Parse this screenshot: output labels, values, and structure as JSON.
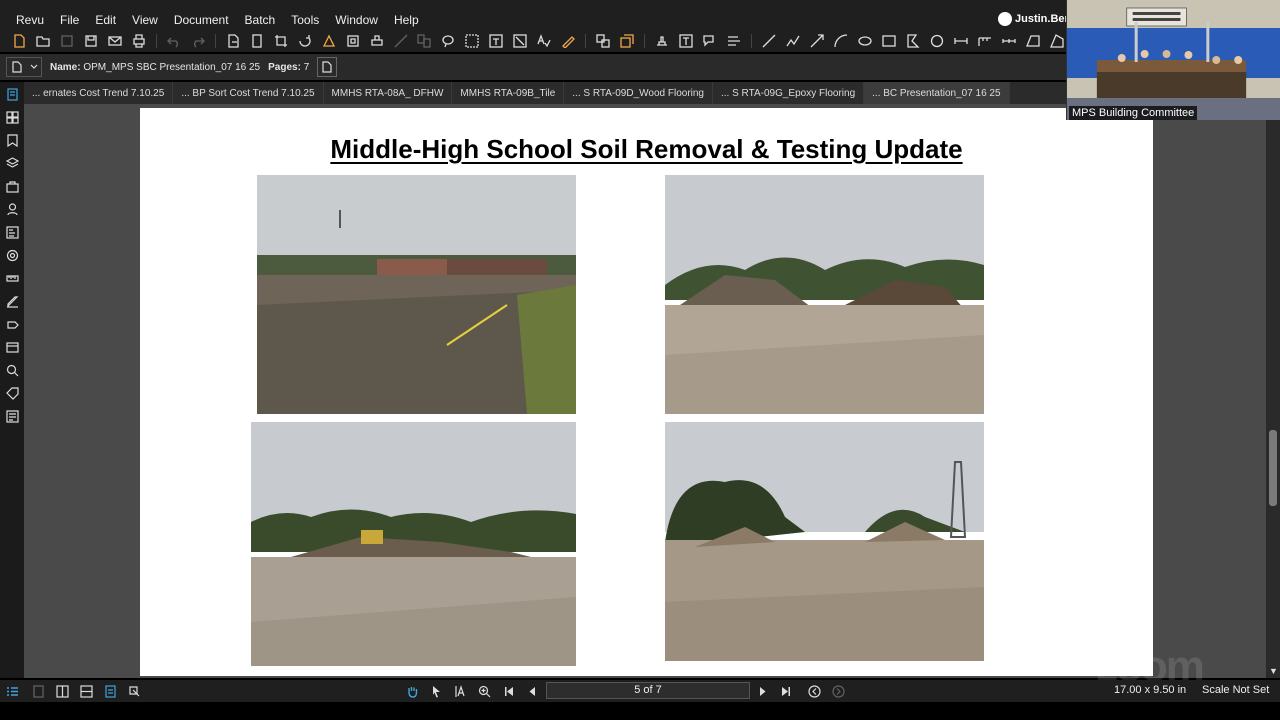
{
  "menu": [
    "Revu",
    "File",
    "Edit",
    "View",
    "Document",
    "Batch",
    "Tools",
    "Window",
    "Help"
  ],
  "user": {
    "name": "Justin.Bern"
  },
  "doc_info": {
    "name_label": "Name:",
    "name_value": "OPM_MPS SBC Presentation_07 16 25",
    "pages_label": "Pages:",
    "pages_value": "7"
  },
  "tabs": [
    "... ernates Cost Trend 7.10.25",
    "... BP Sort Cost Trend 7.10.25",
    "MMHS RTA-08A_ DFHW",
    "MMHS RTA-09B_Tile",
    "... S RTA-09D_Wood Flooring",
    "... S RTA-09G_Epoxy Flooring",
    "... BC Presentation_07 16 25"
  ],
  "active_tab_index": 6,
  "slide": {
    "title": "Middle-High School Soil Removal & Testing Update",
    "photos": [
      "soil-site-photo-1",
      "soil-site-photo-2",
      "soil-site-photo-3",
      "soil-site-photo-4"
    ]
  },
  "navigation": {
    "page_indicator": "5 of 7",
    "dimensions": "17.00 x 9.50 in",
    "scale": "Scale Not Set"
  },
  "video": {
    "participant": "MPS Building Committee"
  },
  "watermark": "zoom",
  "colors": {
    "accent": "#3da5e0",
    "chrome_dark": "#1f1f1f",
    "doc_background": "#4a4a4a"
  }
}
